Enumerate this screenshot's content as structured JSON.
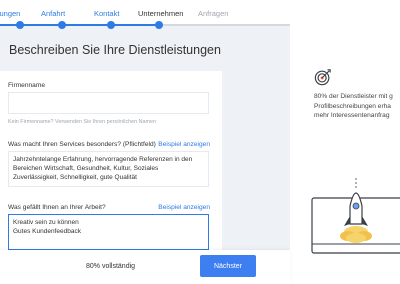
{
  "stepper": {
    "steps": [
      {
        "label": "istungen",
        "state": "done"
      },
      {
        "label": "Anfahrt",
        "state": "done"
      },
      {
        "label": "Kontakt",
        "state": "done"
      },
      {
        "label": "Unternehmen",
        "state": "current"
      },
      {
        "label": "Anfragen",
        "state": "future"
      }
    ]
  },
  "main": {
    "title": "Beschreiben Sie Ihre Dienstleistungen",
    "company_name": {
      "label": "Firmenname",
      "value": "",
      "hint": "Kein Firmenname? Verwenden Sie Ihren persönlichen Namen"
    },
    "special": {
      "label": "Was macht Ihren Services besonders? (Pflichtfeld)",
      "example_link": "Beispiel anzeigen",
      "lines": [
        "Jahrzehntelange Erfahrung, hervorragende Referenzen in den",
        "Bereichen Wirtschaft, Gesundheit, Kultur, Soziales",
        "Zuverlässigkeit, Schnelligkeit, gute Qualität"
      ]
    },
    "likes": {
      "label": "Was gefällt Ihnen an Ihrer Arbeit?",
      "example_link": "Beispiel anzeigen",
      "lines": [
        "Kreativ sein zu können",
        "Gutes Kundenfeedback"
      ]
    }
  },
  "footer": {
    "progress_text": "80% vollständig",
    "progress_percent": 80,
    "next_label": "Nächster"
  },
  "sidebar": {
    "icon": "target-icon",
    "info_lines": [
      "80% der Dienstleister mit g",
      "Profilbeschreibungen erha",
      "mehr Interessentenanfrag"
    ]
  },
  "colors": {
    "accent": "#2d7be5",
    "button": "#3d7ff0",
    "background": "#eef1f5"
  }
}
